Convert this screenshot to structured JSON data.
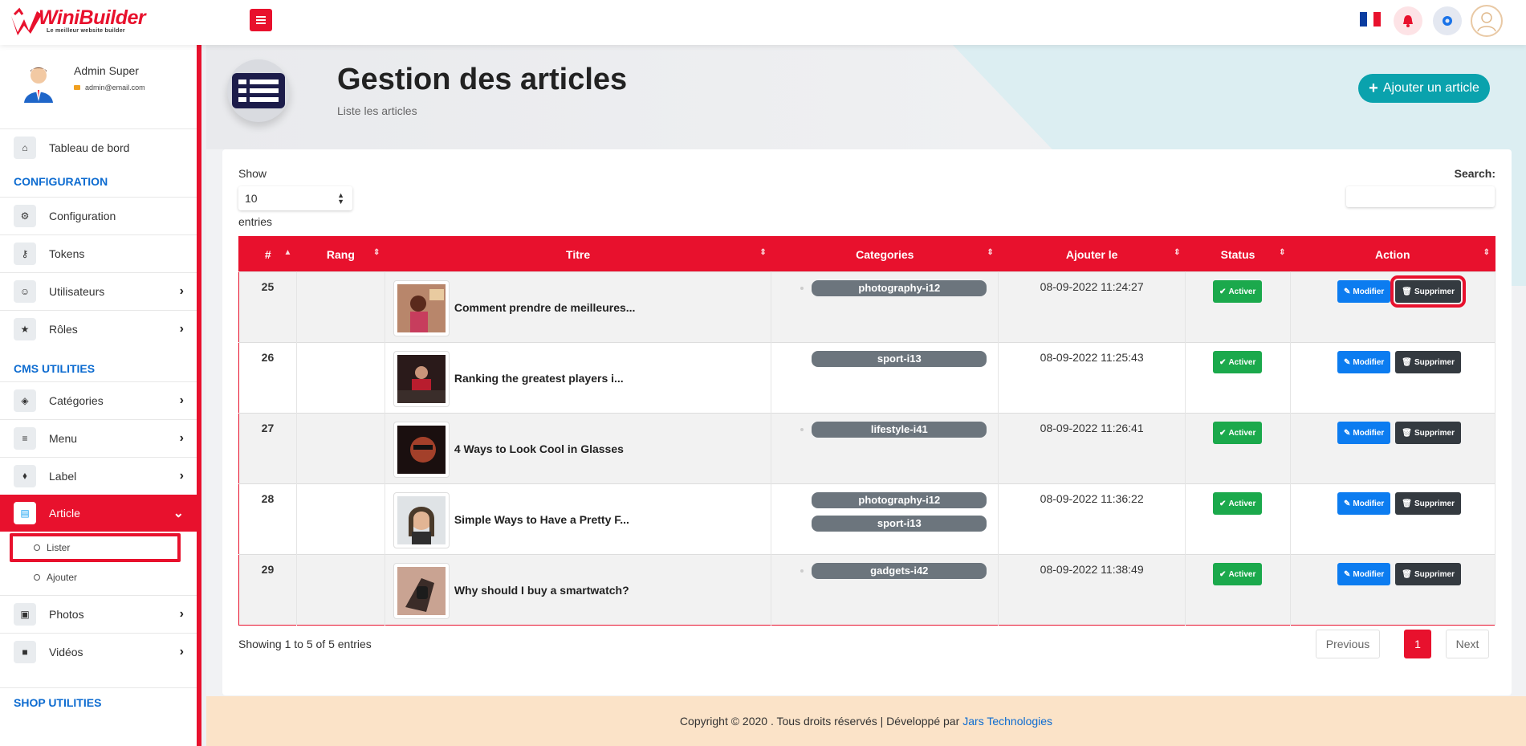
{
  "brand": {
    "name": "WiniBuilder",
    "tagline": "Le meilleur website builder"
  },
  "topbar": {
    "language": "FR"
  },
  "user": {
    "name": "Admin Super",
    "email": "admin@email.com"
  },
  "sidebar": {
    "dashboard": "Tableau de bord",
    "section_config": "CONFIGURATION",
    "configuration": "Configuration",
    "tokens": "Tokens",
    "utilisateurs": "Utilisateurs",
    "roles": "Rôles",
    "section_cms": "CMS UTILITIES",
    "categories": "Catégories",
    "menu": "Menu",
    "label": "Label",
    "article": "Article",
    "sub_lister": "Lister",
    "sub_ajouter": "Ajouter",
    "photos": "Photos",
    "videos": "Vidéos",
    "section_shop": "SHOP UTILITIES"
  },
  "header": {
    "title": "Gestion des articles",
    "subtitle": "Liste les articles",
    "add_button": "Ajouter un article"
  },
  "table_controls": {
    "show_label": "Show",
    "page_size": "10",
    "entries_label": "entries",
    "search_label": "Search:"
  },
  "columns": [
    "#",
    "Rang",
    "Titre",
    "Categories",
    "Ajouter le",
    "Status",
    "Action"
  ],
  "rows": [
    {
      "id": "25",
      "rang": "",
      "title": "Comment prendre de meilleures...",
      "categories": [
        "photography-i12"
      ],
      "date": "08-09-2022 11:24:27",
      "status": "Activer"
    },
    {
      "id": "26",
      "rang": "",
      "title": "Ranking the greatest players i...",
      "categories": [
        "sport-i13"
      ],
      "date": "08-09-2022 11:25:43",
      "status": "Activer"
    },
    {
      "id": "27",
      "rang": "",
      "title": "4 Ways to Look Cool in Glasses",
      "categories": [
        "lifestyle-i41"
      ],
      "date": "08-09-2022 11:26:41",
      "status": "Activer"
    },
    {
      "id": "28",
      "rang": "",
      "title": "Simple Ways to Have a Pretty F...",
      "categories": [
        "photography-i12",
        "sport-i13"
      ],
      "date": "08-09-2022 11:36:22",
      "status": "Activer"
    },
    {
      "id": "29",
      "rang": "",
      "title": "Why should I buy a smartwatch?",
      "categories": [
        "gadgets-i42"
      ],
      "date": "08-09-2022 11:38:49",
      "status": "Activer"
    }
  ],
  "actions": {
    "edit": "Modifier",
    "delete": "Supprimer"
  },
  "pagination": {
    "summary": "Showing 1 to 5 of 5 entries",
    "previous": "Previous",
    "current": "1",
    "next": "Next"
  },
  "footer": {
    "text": "Copyright © 2020 . Tous droits réservés | Développé par",
    "link": "Jars Technologies"
  },
  "colors": {
    "primary": "#e8112d",
    "teal": "#0aa2ad",
    "success": "#1ba94c",
    "edit": "#0c7cf0",
    "dark": "#343a40",
    "badge": "#6c757d"
  }
}
